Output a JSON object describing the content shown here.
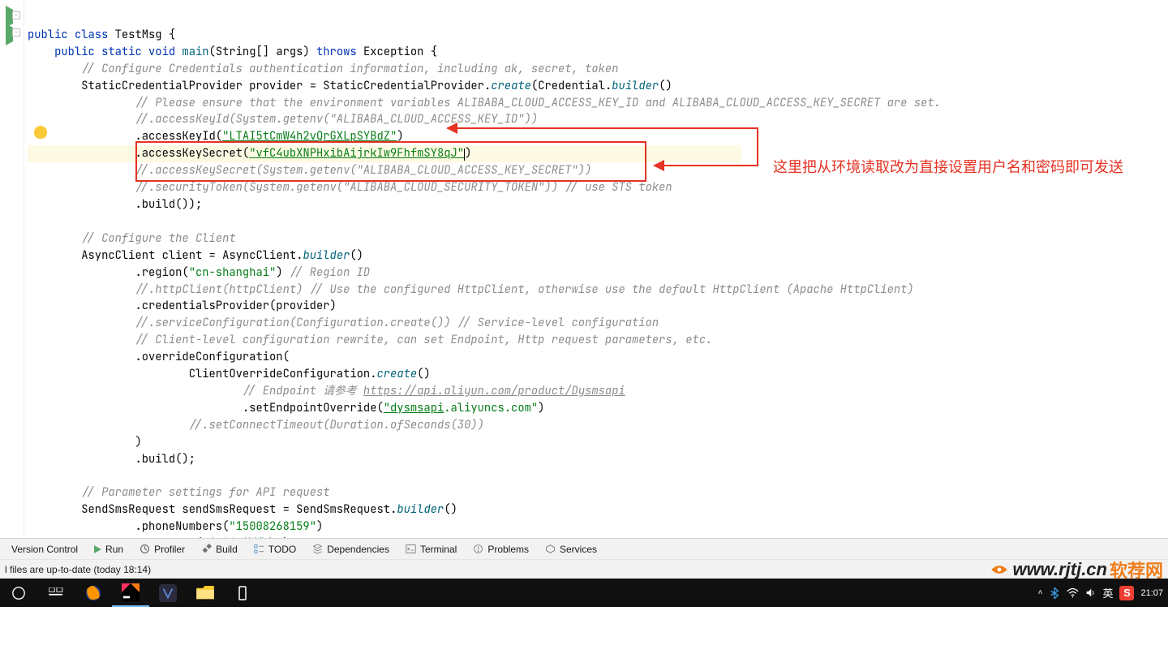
{
  "code": {
    "class_decl_kw": "public class",
    "class_name": "TestMsg",
    "main_decl": "public static void",
    "main_name": "main",
    "main_args": "(String[] args)",
    "throws_kw": "throws",
    "exception": "Exception",
    "comment1": "// Configure Credentials authentication information, including ak, secret, token",
    "provider_type": "StaticCredentialProvider",
    "provider_var": "provider",
    "provider_rhs": "StaticCredentialProvider",
    "create": "create",
    "credential": "Credential",
    "builder": "builder",
    "comment2": "// Please ensure that the environment variables ALIBABA_CLOUD_ACCESS_KEY_ID and ALIBABA_CLOUD_ACCESS_KEY_SECRET are set.",
    "comment3": "//.accessKeyId(System.getenv(\"ALIBABA_CLOUD_ACCESS_KEY_ID\"))",
    "accessKeyId": ".accessKeyId(",
    "akid_val": "\"LTAI5tCmW4h2vQrGXLpSYBdZ\"",
    "accessKeySecret": ".accessKeySecret(",
    "aks_val": "\"vfC4ubXNPHxibAijrkIw9FhfmSY8qJ\"",
    "comment4": "//.accessKeySecret(System.getenv(\"ALIBABA_CLOUD_ACCESS_KEY_SECRET\"))",
    "comment5": "//.securityToken(System.getenv(\"ALIBABA_CLOUD_SECURITY_TOKEN\")) // use STS token",
    "build": ".build());",
    "comment6": "// Configure the Client",
    "client_type": "AsyncClient",
    "client_var": "client",
    "client_rhs": "AsyncClient",
    "region": ".region(",
    "region_val": "\"cn-shanghai\"",
    "region_comment": " // Region ID",
    "comment7": "//.httpClient(httpClient) // Use the configured HttpClient, otherwise use the default HttpClient (Apache HttpClient)",
    "credProvider": ".credentialsProvider(provider)",
    "comment8": "//.serviceConfiguration(Configuration.create()) // Service-level configuration",
    "comment9": "// Client-level configuration rewrite, can set Endpoint, Http request parameters, etc.",
    "override": ".overrideConfiguration(",
    "override_type": "ClientOverrideConfiguration",
    "comment_endpoint": "// Endpoint 请参考 ",
    "endpoint_url": "https://api.aliyun.com/product/Dysmsapi",
    "setEndpoint": ".setEndpointOverride(",
    "endpoint_val_1": "\"dysmsapi",
    "endpoint_val_2": ".aliyuncs",
    "endpoint_val_3": ".com\"",
    "comment10": "//.setConnectTimeout(Duration.ofSeconds(30))",
    "close_paren": ")",
    "build2": ".build();",
    "comment11": "// Parameter settings for API request",
    "sms_type": "SendSmsRequest",
    "sms_var": "sendSmsRequest",
    "sms_rhs": "SendSmsRequest",
    "phoneNumbers": ".phoneNumbers(",
    "phone_val": "\"15008268159\"",
    "signName": ".signName(",
    "sign_val": "\"段小江的博客\""
  },
  "annotation": "这里把从环境读取改为直接设置用户名和密码即可发送",
  "toolbar": {
    "version_control": "Version Control",
    "run": "Run",
    "profiler": "Profiler",
    "build": "Build",
    "todo": "TODO",
    "dependencies": "Dependencies",
    "terminal": "Terminal",
    "problems": "Problems",
    "services": "Services"
  },
  "status": "l files are up-to-date (today 18:14)",
  "watermark_domain": "www.rjtj.cn",
  "watermark_text": "软荐网",
  "tray": {
    "ime": "英",
    "time": "21:07"
  }
}
